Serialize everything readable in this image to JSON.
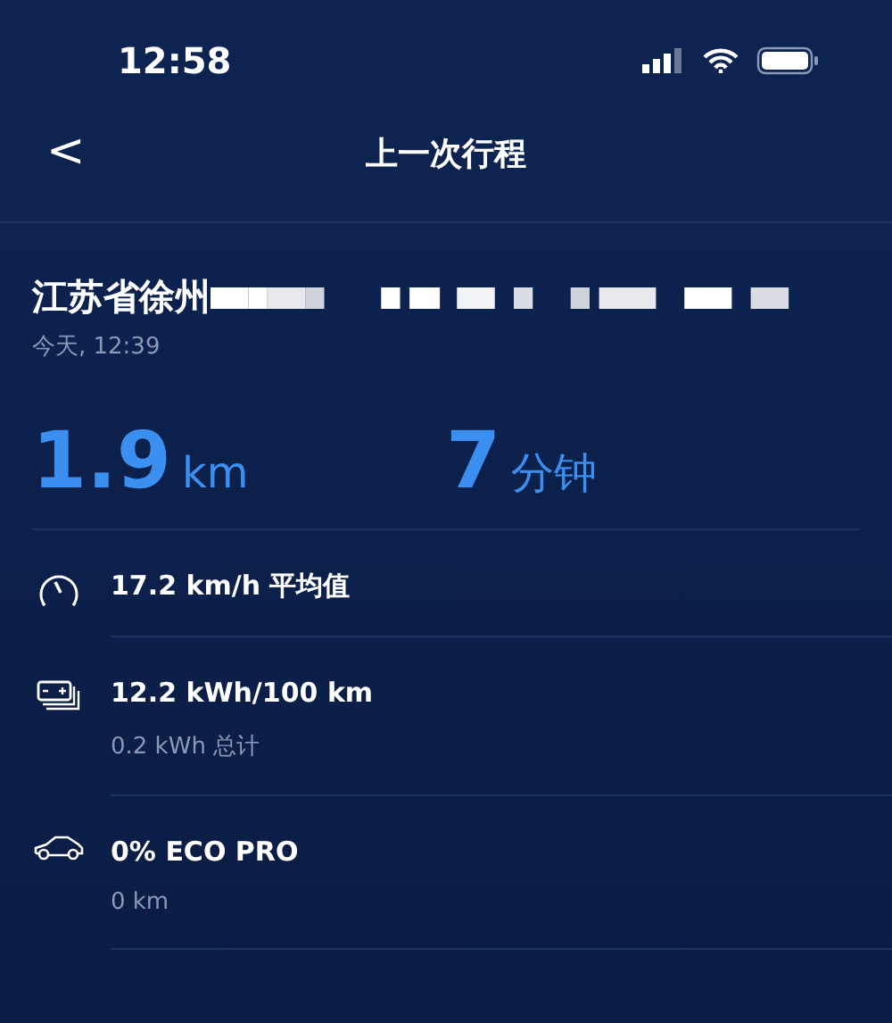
{
  "status_bar": {
    "time": "12:58"
  },
  "nav": {
    "back": "<",
    "title": "上一次行程"
  },
  "trip": {
    "address": "江苏省徐州",
    "time": "今天, 12:39"
  },
  "summary": [
    {
      "value": "1.9",
      "unit": "km"
    },
    {
      "value": "7",
      "unit": "分钟"
    }
  ],
  "stats": [
    {
      "kind": "speed",
      "title": "17.2 km/h 平均值"
    },
    {
      "kind": "energy",
      "title": "12.2 kWh/100 km",
      "subtitle": "0.2 kWh 总计"
    },
    {
      "kind": "eco",
      "title": "0% ECO PRO",
      "subtitle": "0 km"
    }
  ]
}
